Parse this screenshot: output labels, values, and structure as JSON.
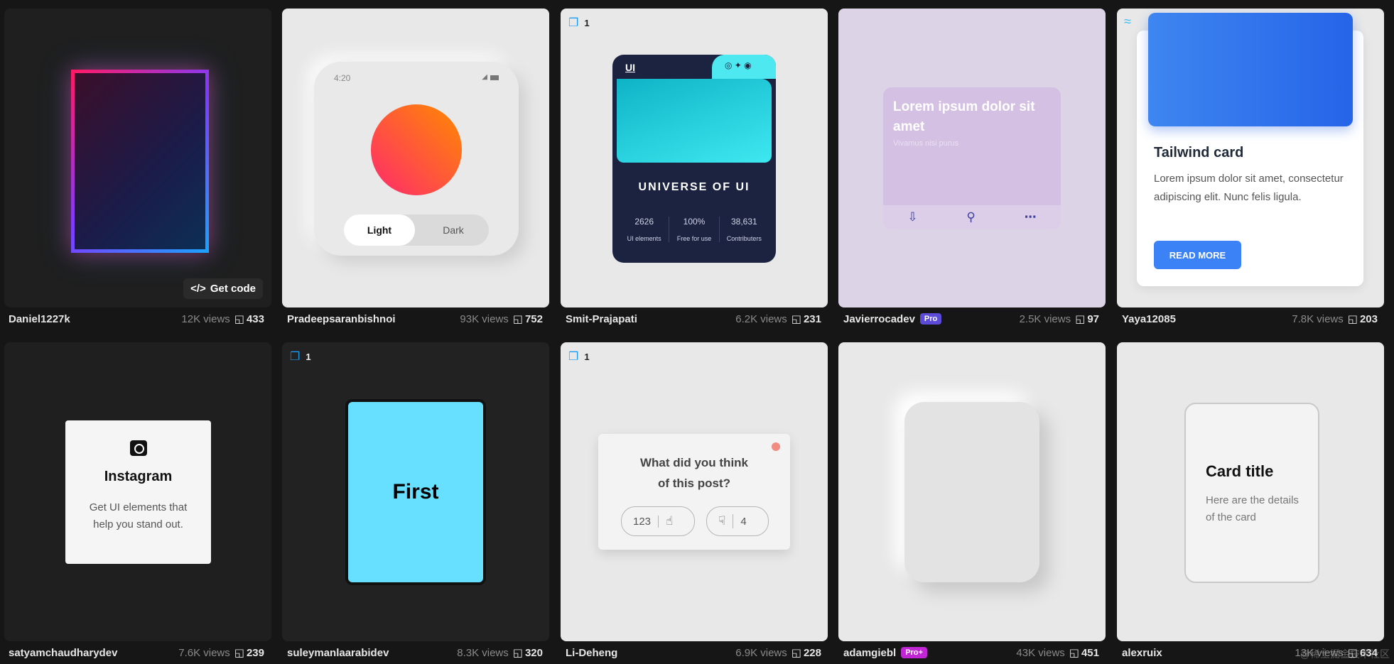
{
  "cards": [
    {
      "user": "Daniel1227k",
      "views": "12K views",
      "saves": "433",
      "get_code": "Get code"
    },
    {
      "user": "Pradeepsaranbishnoi",
      "views": "93K views",
      "saves": "752",
      "time": "4:20",
      "toggle_on": "Light",
      "toggle_off": "Dark"
    },
    {
      "user": "Smit-Prajapati",
      "views": "6.2K views",
      "saves": "231",
      "count": "1",
      "logo": "UI",
      "title": "UNIVERSE OF UI",
      "stats": [
        {
          "value": "2626",
          "label": "UI elements"
        },
        {
          "value": "100%",
          "label": "Free for use"
        },
        {
          "value": "38,631",
          "label": "Contributers"
        }
      ]
    },
    {
      "user": "Javierrocadev",
      "badge": "Pro",
      "views": "2.5K views",
      "saves": "97",
      "title": "Lorem ipsum dolor sit amet",
      "subtitle": "Vivamus nisi purus"
    },
    {
      "user": "Yaya12085",
      "views": "7.8K views",
      "saves": "203",
      "title": "Tailwind card",
      "body": "Lorem ipsum dolor sit amet, consectetur adipiscing elit. Nunc felis ligula.",
      "button": "READ MORE"
    },
    {
      "user": "satyamchaudharydev",
      "views": "7.6K views",
      "saves": "239",
      "title": "Instagram",
      "body": "Get UI elements that help you stand out."
    },
    {
      "user": "suleymanlaarabidev",
      "views": "8.3K views",
      "saves": "320",
      "count": "1",
      "word": "First"
    },
    {
      "user": "Li-Deheng",
      "views": "6.9K views",
      "saves": "228",
      "count": "1",
      "question": "What did you think of this post?",
      "likes": "123",
      "dislikes": "4"
    },
    {
      "user": "adamgiebl",
      "badge": "Pro+",
      "views": "43K views",
      "saves": "451"
    },
    {
      "user": "alexruix",
      "views": "13K views",
      "saves": "634",
      "title": "Card title",
      "body": "Here are the details of the card"
    }
  ],
  "watermark": "@稀土掘金技术社区",
  "colors": {
    "page_bg": "#161616",
    "accent_blue": "#3b82f6",
    "pro_badge": "#5b4bd8",
    "proplus_badge": "#c026d3"
  }
}
